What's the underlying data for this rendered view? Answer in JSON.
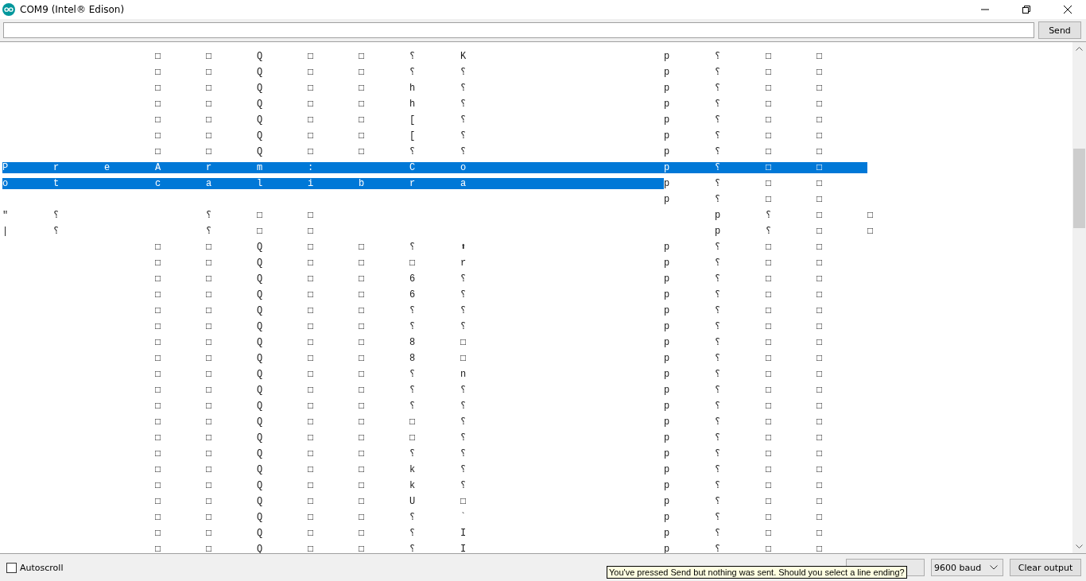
{
  "window": {
    "title": "COM9 (Intel® Edison)"
  },
  "send_button": "Send",
  "output_lines": [
    [
      {
        "text": "\t\t\t□\t□\tQ\t□\t□\t⸮\tK\t\t\t\tp\t⸮\t□\t□",
        "selected": false
      }
    ],
    [
      {
        "text": "\t\t\t□\t□\tQ\t□\t□\t⸮\t⸮\t\t\t\tp\t⸮\t□\t□",
        "selected": false
      }
    ],
    [
      {
        "text": "\t\t\t□\t□\tQ\t□\t□\th\t⸮\t\t\t\tp\t⸮\t□\t□",
        "selected": false
      }
    ],
    [
      {
        "text": "\t\t\t□\t□\tQ\t□\t□\th\t⸮\t\t\t\tp\t⸮\t□\t□",
        "selected": false
      }
    ],
    [
      {
        "text": "\t\t\t□\t□\tQ\t□\t□\t[\t⸮\t\t\t\tp\t⸮\t□\t□",
        "selected": false
      }
    ],
    [
      {
        "text": "\t\t\t□\t□\tQ\t□\t□\t[\t⸮\t\t\t\tp\t⸮\t□\t□",
        "selected": false
      }
    ],
    [
      {
        "text": "\t\t\t□\t□\tQ\t□\t□\t⸮\t⸮\t\t\t\tp\t⸮\t□\t□",
        "selected": false
      }
    ],
    [
      {
        "text": "P\tr\te\tA\tr\tm\t:\t \tC\to\t\t\t\tp\t⸮\t□\t□\t",
        "selected": true
      }
    ],
    [
      {
        "text": "o\tt\t \tc\ta\tl\ti\tb\tr\ta\t\t\t\t",
        "selected": true
      },
      {
        "text": "p\t⸮\t□\t□",
        "selected": false
      }
    ],
    [
      {
        "text": "\t\t\t\t\t\t\t\t\t\t\t\t\tp\t⸮\t□\t□",
        "selected": false
      }
    ],
    [
      {
        "text": "\"\t⸮\t\t\t⸮\t□\t□\t\t\t\t\t\t\t\tp\t⸮\t□\t□",
        "selected": false
      }
    ],
    [
      {
        "text": "|\t⸮\t\t\t⸮\t□\t□\t\t\t\t\t\t\t\tp\t⸮\t□\t□",
        "selected": false
      }
    ],
    [
      {
        "text": "\t\t\t□\t□\tQ\t□\t□\t⸮\t⬆\t\t\t\tp\t⸮\t□\t□",
        "selected": false
      }
    ],
    [
      {
        "text": "\t\t\t□\t□\tQ\t□\t□\t□\tr\t\t\t\tp\t⸮\t□\t□",
        "selected": false
      }
    ],
    [
      {
        "text": "\t\t\t□\t□\tQ\t□\t□\t6\t⸮\t\t\t\tp\t⸮\t□\t□",
        "selected": false
      }
    ],
    [
      {
        "text": "\t\t\t□\t□\tQ\t□\t□\t6\t⸮\t\t\t\tp\t⸮\t□\t□",
        "selected": false
      }
    ],
    [
      {
        "text": "\t\t\t□\t□\tQ\t□\t□\t⸮\t⸮\t\t\t\tp\t⸮\t□\t□",
        "selected": false
      }
    ],
    [
      {
        "text": "\t\t\t□\t□\tQ\t□\t□\t⸮\t⸮\t\t\t\tp\t⸮\t□\t□",
        "selected": false
      }
    ],
    [
      {
        "text": "\t\t\t□\t□\tQ\t□\t□\t8\t□\t\t\t\tp\t⸮\t□\t□",
        "selected": false
      }
    ],
    [
      {
        "text": "\t\t\t□\t□\tQ\t□\t□\t8\t□\t\t\t\tp\t⸮\t□\t□",
        "selected": false
      }
    ],
    [
      {
        "text": "\t\t\t□\t□\tQ\t□\t□\t⸮\tn\t\t\t\tp\t⸮\t□\t□",
        "selected": false
      }
    ],
    [
      {
        "text": "\t\t\t□\t□\tQ\t□\t□\t⸮\t⸮\t\t\t\tp\t⸮\t□\t□",
        "selected": false
      }
    ],
    [
      {
        "text": "\t\t\t□\t□\tQ\t□\t□\t⸮\t⸮\t\t\t\tp\t⸮\t□\t□",
        "selected": false
      }
    ],
    [
      {
        "text": "\t\t\t□\t□\tQ\t□\t□\t□\t⸮\t\t\t\tp\t⸮\t□\t□",
        "selected": false
      }
    ],
    [
      {
        "text": "\t\t\t□\t□\tQ\t□\t□\t□\t⸮\t\t\t\tp\t⸮\t□\t□",
        "selected": false
      }
    ],
    [
      {
        "text": "\t\t\t□\t□\tQ\t□\t□\t⸮\t⸮\t\t\t\tp\t⸮\t□\t□",
        "selected": false
      }
    ],
    [
      {
        "text": "\t\t\t□\t□\tQ\t□\t□\tk\t⸮\t\t\t\tp\t⸮\t□\t□",
        "selected": false
      }
    ],
    [
      {
        "text": "\t\t\t□\t□\tQ\t□\t□\tk\t⸮\t\t\t\tp\t⸮\t□\t□",
        "selected": false
      }
    ],
    [
      {
        "text": "\t\t\t□\t□\tQ\t□\t□\tU\t□\t\t\t\tp\t⸮\t□\t□",
        "selected": false
      }
    ],
    [
      {
        "text": "\t\t\t□\t□\tQ\t□\t□\t⸮\t`\t\t\t\tp\t⸮\t□\t□",
        "selected": false
      }
    ],
    [
      {
        "text": "\t\t\t□\t□\tQ\t□\t□\t⸮\tI\t\t\t\tp\t⸮\t□\t□",
        "selected": false
      }
    ],
    [
      {
        "text": "\t\t\t□\t□\tQ\t□\t□\t⸮\tI\t\t\t\tp\t⸮\t□\t□",
        "selected": false
      }
    ]
  ],
  "autoscroll": {
    "label": "Autoscroll",
    "checked": false
  },
  "baud_dropdown": "9600 baud",
  "clear_button": "Clear output",
  "tooltip": "You've pressed Send but nothing was sent. Should you select a line ending?"
}
